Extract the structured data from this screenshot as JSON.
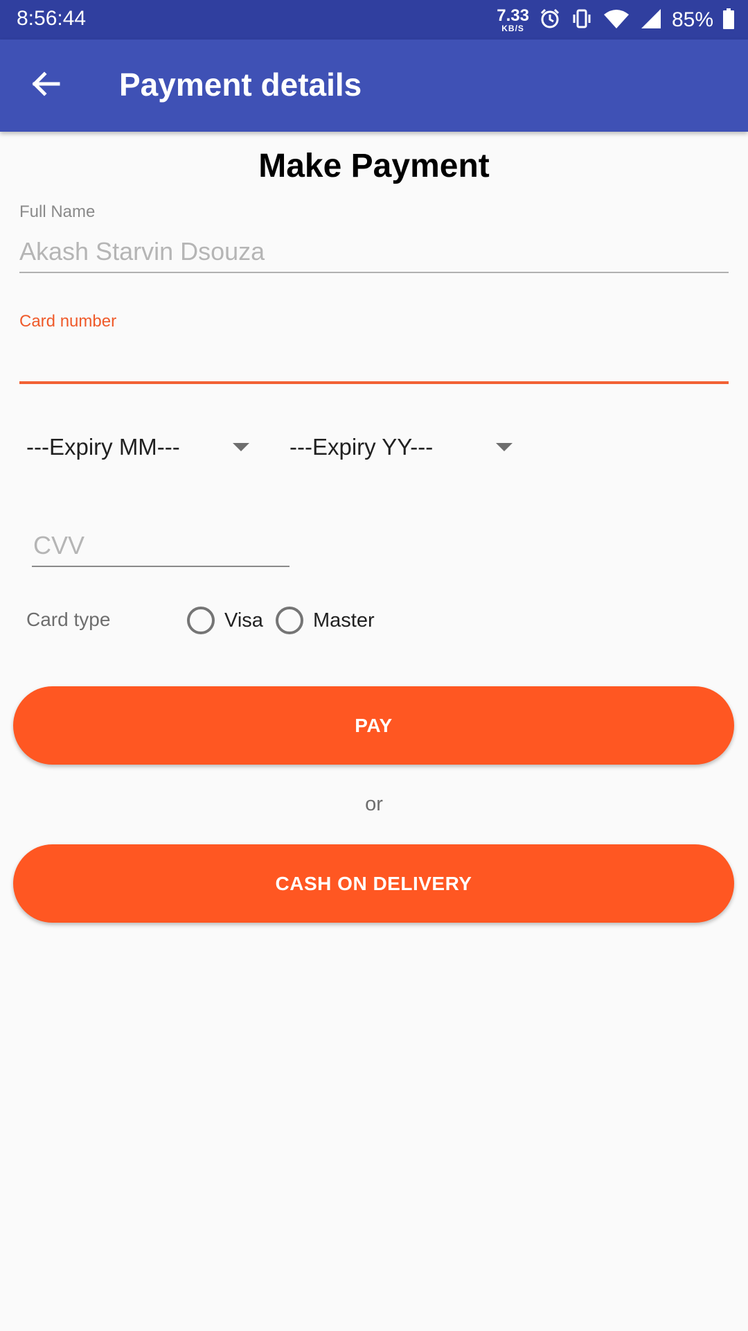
{
  "status_bar": {
    "time": "8:56:44",
    "net_speed_value": "7.33",
    "net_speed_unit": "KB/S",
    "battery": "85%",
    "icons": [
      "alarm-icon",
      "vibrate-icon",
      "wifi-icon",
      "signal-icon",
      "battery-icon"
    ]
  },
  "app_bar": {
    "title": "Payment details",
    "back_icon": "arrow-left-icon",
    "color": "#3f51b5"
  },
  "form": {
    "heading": "Make Payment",
    "full_name_label": "Full Name",
    "full_name_value": "Akash Starvin Dsouza",
    "card_number_label": "Card number",
    "card_number_value": "",
    "expiry_month_selected": "---Expiry MM---",
    "expiry_year_selected": "---Expiry YY---",
    "cvv_placeholder": "CVV",
    "card_type_label": "Card type",
    "card_type_options": [
      "Visa",
      "Master"
    ],
    "pay_button": "PAY",
    "or_text": "or",
    "cod_button": "CASH ON DELIVERY",
    "accent_color": "#ff5722"
  }
}
